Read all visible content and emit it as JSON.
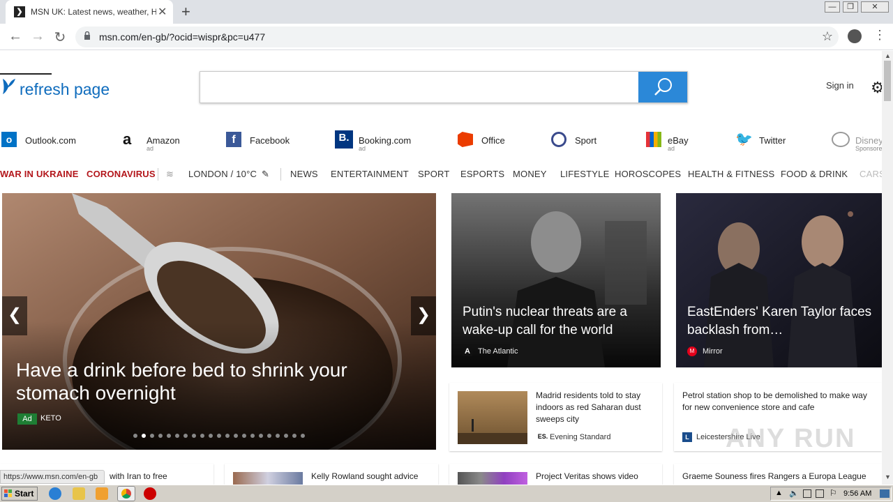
{
  "browser": {
    "tab_title": "MSN UK: Latest news, weather, Hot",
    "tab_close": "✕",
    "new_tab": "+",
    "url": "msn.com/en-gb/?ocid=wispr&pc=u477",
    "window_minimize": "—",
    "window_restore": "❐",
    "window_close": "✕"
  },
  "header": {
    "logo_text": "refresh page",
    "sign_in": "Sign in"
  },
  "quick_links": [
    {
      "label": "Outlook.com",
      "ad": ""
    },
    {
      "label": "Amazon",
      "ad": "ad"
    },
    {
      "label": "Facebook",
      "ad": ""
    },
    {
      "label": "Booking.com",
      "ad": "ad"
    },
    {
      "label": "Office",
      "ad": ""
    },
    {
      "label": "Sport",
      "ad": ""
    },
    {
      "label": "eBay",
      "ad": "ad"
    },
    {
      "label": "Twitter",
      "ad": ""
    },
    {
      "label": "Disney",
      "ad": "Sponsore"
    }
  ],
  "nav": {
    "war": "WAR IN UKRAINE",
    "coronavirus": "CORONAVIRUS",
    "weather": "LONDON / 10°C",
    "items": [
      "NEWS",
      "ENTERTAINMENT",
      "SPORT",
      "ESPORTS",
      "MONEY",
      "LIFESTYLE",
      "HOROSCOPES",
      "HEALTH & FITNESS",
      "FOOD & DRINK",
      "CARS"
    ]
  },
  "hero": {
    "headline": "Have a drink before bed to shrink your stomach overnight",
    "ad_label": "Ad",
    "source": "KETO",
    "dot_count": 21,
    "active_dot": 1
  },
  "cards": [
    {
      "title": "Putin's nuclear threats are a wake-up call for the world",
      "source": "The Atlantic",
      "source_icon": "A"
    },
    {
      "title": "EastEnders' Karen Taylor faces backlash from…",
      "source": "Mirror",
      "source_icon": "M"
    }
  ],
  "small_cards": [
    {
      "title": "Madrid residents told to stay indoors as red Saharan dust sweeps city",
      "source": "Evening Standard",
      "source_icon": "ES."
    },
    {
      "title": "Petrol station shop to be demolished to make way for new convenience store and cafe",
      "source": "Leicestershire Live",
      "source_icon": "L"
    }
  ],
  "bottom_row": [
    "with Iran to free",
    "Kelly Rowland sought advice",
    "Project Veritas shows video",
    "Graeme Souness fires Rangers a Europa League"
  ],
  "status_url": "https://www.msn.com/en-gb",
  "watermark": "ANY RUN",
  "taskbar": {
    "start": "Start",
    "clock": "9:56 AM"
  },
  "colors": {
    "accent": "#2b88d8",
    "nav_red": "#b3161b",
    "logo_blue": "#0f6cbd"
  }
}
